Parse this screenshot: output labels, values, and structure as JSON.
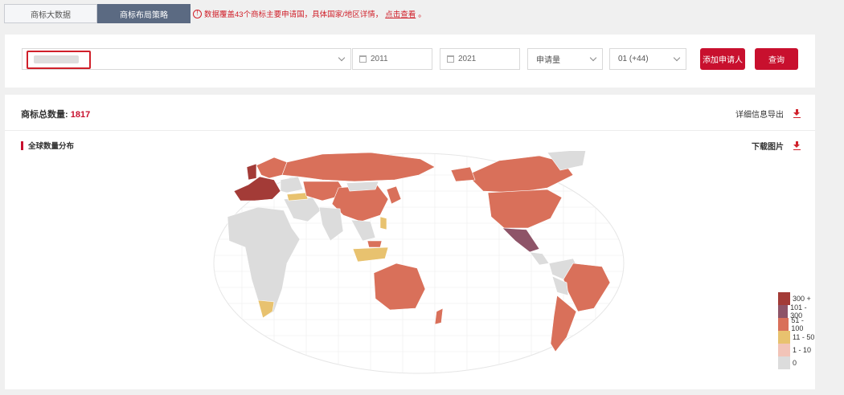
{
  "tabs": [
    {
      "label": "商标大数据",
      "active": false
    },
    {
      "label": "商标布局策略",
      "active": true
    }
  ],
  "notice": {
    "text": "数据覆盖43个商标主要申请国，具体国家/地区详情，",
    "link": "点击查看",
    "end": "。"
  },
  "search": {
    "start_year": "2011",
    "end_year": "2021",
    "metric": "申请量",
    "class": "01 (+44)",
    "add_label": "添加申请人",
    "query_label": "查询"
  },
  "summary": {
    "label": "商标总数量:",
    "count": "1817",
    "export_label": "详细信息导出"
  },
  "map_section": {
    "title": "全球数量分布",
    "download_label": "下载图片"
  },
  "colors": {
    "c300": "#a33b37",
    "c101": "#8e5468",
    "c51": "#d9705a",
    "c11": "#e8c26f",
    "c1": "#f2c4b8",
    "c0": "#dcdcdc",
    "accent": "#c8102e"
  },
  "legend": [
    {
      "label": "300 +",
      "color": "#a33b37"
    },
    {
      "label": "101 - 300",
      "color": "#8e5468"
    },
    {
      "label": "51 - 100",
      "color": "#d9705a"
    },
    {
      "label": "11 - 50",
      "color": "#e8c26f"
    },
    {
      "label": "1 - 10",
      "color": "#f2c4b8"
    },
    {
      "label": "0",
      "color": "#dcdcdc"
    }
  ]
}
